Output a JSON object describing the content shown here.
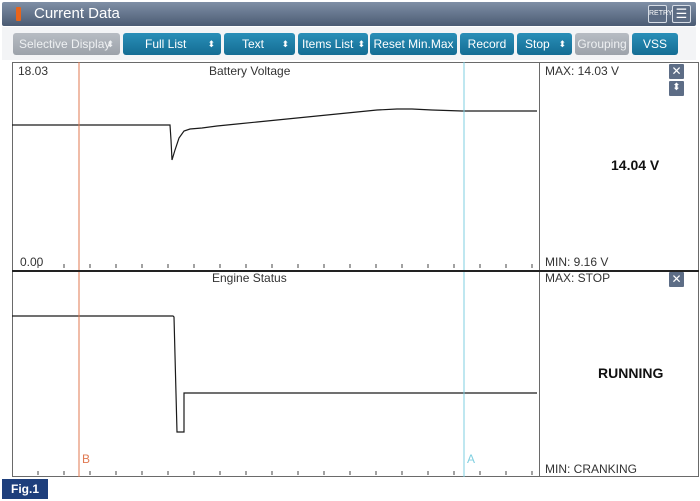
{
  "window": {
    "title": "Current Data",
    "retry_label": "RETRY"
  },
  "toolbar": {
    "selective_display": "Selective Display",
    "full_list": "Full List",
    "text": "Text",
    "items_list": "Items List",
    "reset_minmax": "Reset Min.Max",
    "record": "Record",
    "stop": "Stop",
    "grouping": "Grouping",
    "vss": "VSS"
  },
  "panels": [
    {
      "name": "Battery Voltage",
      "y_max_label": "18.03",
      "y_min_label": "0.00",
      "max_text": "MAX: 14.03 V",
      "min_text": "MIN: 9.16 V",
      "current_value": "14.04 V"
    },
    {
      "name": "Engine Status",
      "max_text": "MAX: STOP",
      "min_text": "MIN: CRANKING",
      "current_value": "RUNNING"
    }
  ],
  "cursors": {
    "left": "B",
    "right": "A"
  },
  "figure_label": "Fig.1",
  "colors": {
    "accent": "#146c93",
    "cursor_b": "#e07a52",
    "cursor_a": "#7fcfe0"
  }
}
